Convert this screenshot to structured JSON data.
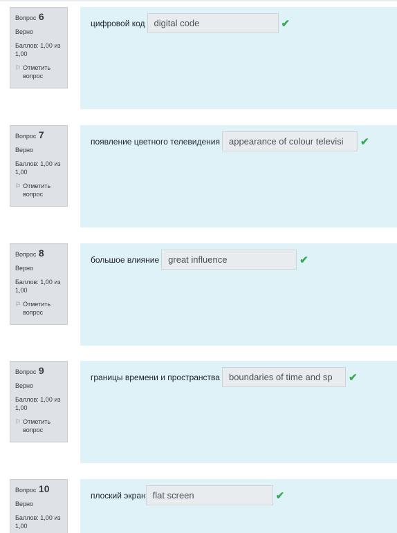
{
  "questions": [
    {
      "label": "Вопрос",
      "number": "6",
      "state": "Верно",
      "grade": "Баллов: 1,00 из 1,00",
      "flag": "Отметить вопрос",
      "prompt": "цифровой код",
      "answer": "digital code"
    },
    {
      "label": "Вопрос",
      "number": "7",
      "state": "Верно",
      "grade": "Баллов: 1,00 из 1,00",
      "flag": "Отметить вопрос",
      "prompt": "появление цветного телевидения",
      "answer": "appearance of colour televisi"
    },
    {
      "label": "Вопрос",
      "number": "8",
      "state": "Верно",
      "grade": "Баллов: 1,00 из 1,00",
      "flag": "Отметить вопрос",
      "prompt": "большое влияние",
      "answer": "great influence"
    },
    {
      "label": "Вопрос",
      "number": "9",
      "state": "Верно",
      "grade": "Баллов: 1,00 из 1,00",
      "flag": "Отметить вопрос",
      "prompt": "границы времени и пространства",
      "answer": "boundaries of time and sp"
    },
    {
      "label": "Вопрос",
      "number": "10",
      "state": "Верно",
      "grade": "Баллов: 1,00 из 1,00",
      "prompt": "плоский экран",
      "answer": "flat screen"
    }
  ],
  "icons": {
    "flag": "flag-icon",
    "correct": "checkmark-icon"
  },
  "colors": {
    "panel": "#def2f8",
    "info": "#dee2e6",
    "correct": "#3aa757"
  }
}
